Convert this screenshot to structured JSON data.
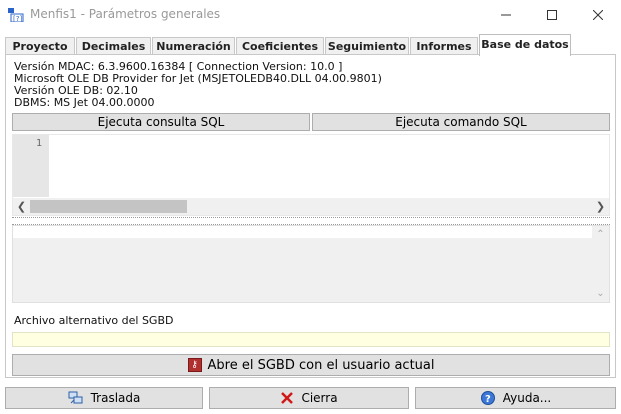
{
  "window": {
    "title": "Menfis1 - Parámetros generales",
    "controls": [
      "minimize",
      "maximize",
      "close"
    ]
  },
  "tabs": [
    {
      "label": "Proyecto",
      "active": false
    },
    {
      "label": "Decimales",
      "active": false
    },
    {
      "label": "Numeración",
      "active": false
    },
    {
      "label": "Coeficientes",
      "active": false
    },
    {
      "label": "Seguimiento",
      "active": false
    },
    {
      "label": "Informes",
      "active": false
    },
    {
      "label": "Base de datos",
      "active": true
    }
  ],
  "info": {
    "line1": "Versión MDAC: 6.3.9600.16384  [ Connection Version: 10.0 ]",
    "line2": "Microsoft OLE DB Provider for Jet (MSJETOLEDB40.DLL 04.00.9801)",
    "line3": "Versión OLE DB: 02.10",
    "line4": "DBMS: MS Jet 04.00.0000"
  },
  "sql": {
    "query_button": "Ejecuta consulta SQL",
    "command_button": "Ejecuta comando SQL",
    "line_number": "1"
  },
  "alt_db": {
    "label": "Archivo alternativo del SGBD",
    "value": ""
  },
  "open_button": "Abre el SGBD con el usuario actual",
  "footer": {
    "traslada": "Traslada",
    "cierra": "Cierra",
    "ayuda": "Ayuda..."
  },
  "icons": {
    "app": "app-icon",
    "open": "key-icon",
    "traslada": "transfer-icon",
    "cierra": "close-x-icon",
    "ayuda": "help-icon"
  },
  "colors": {
    "input_bg": "#ffffe1",
    "button_bg": "#e1e1e1",
    "close_red": "#d01818"
  }
}
